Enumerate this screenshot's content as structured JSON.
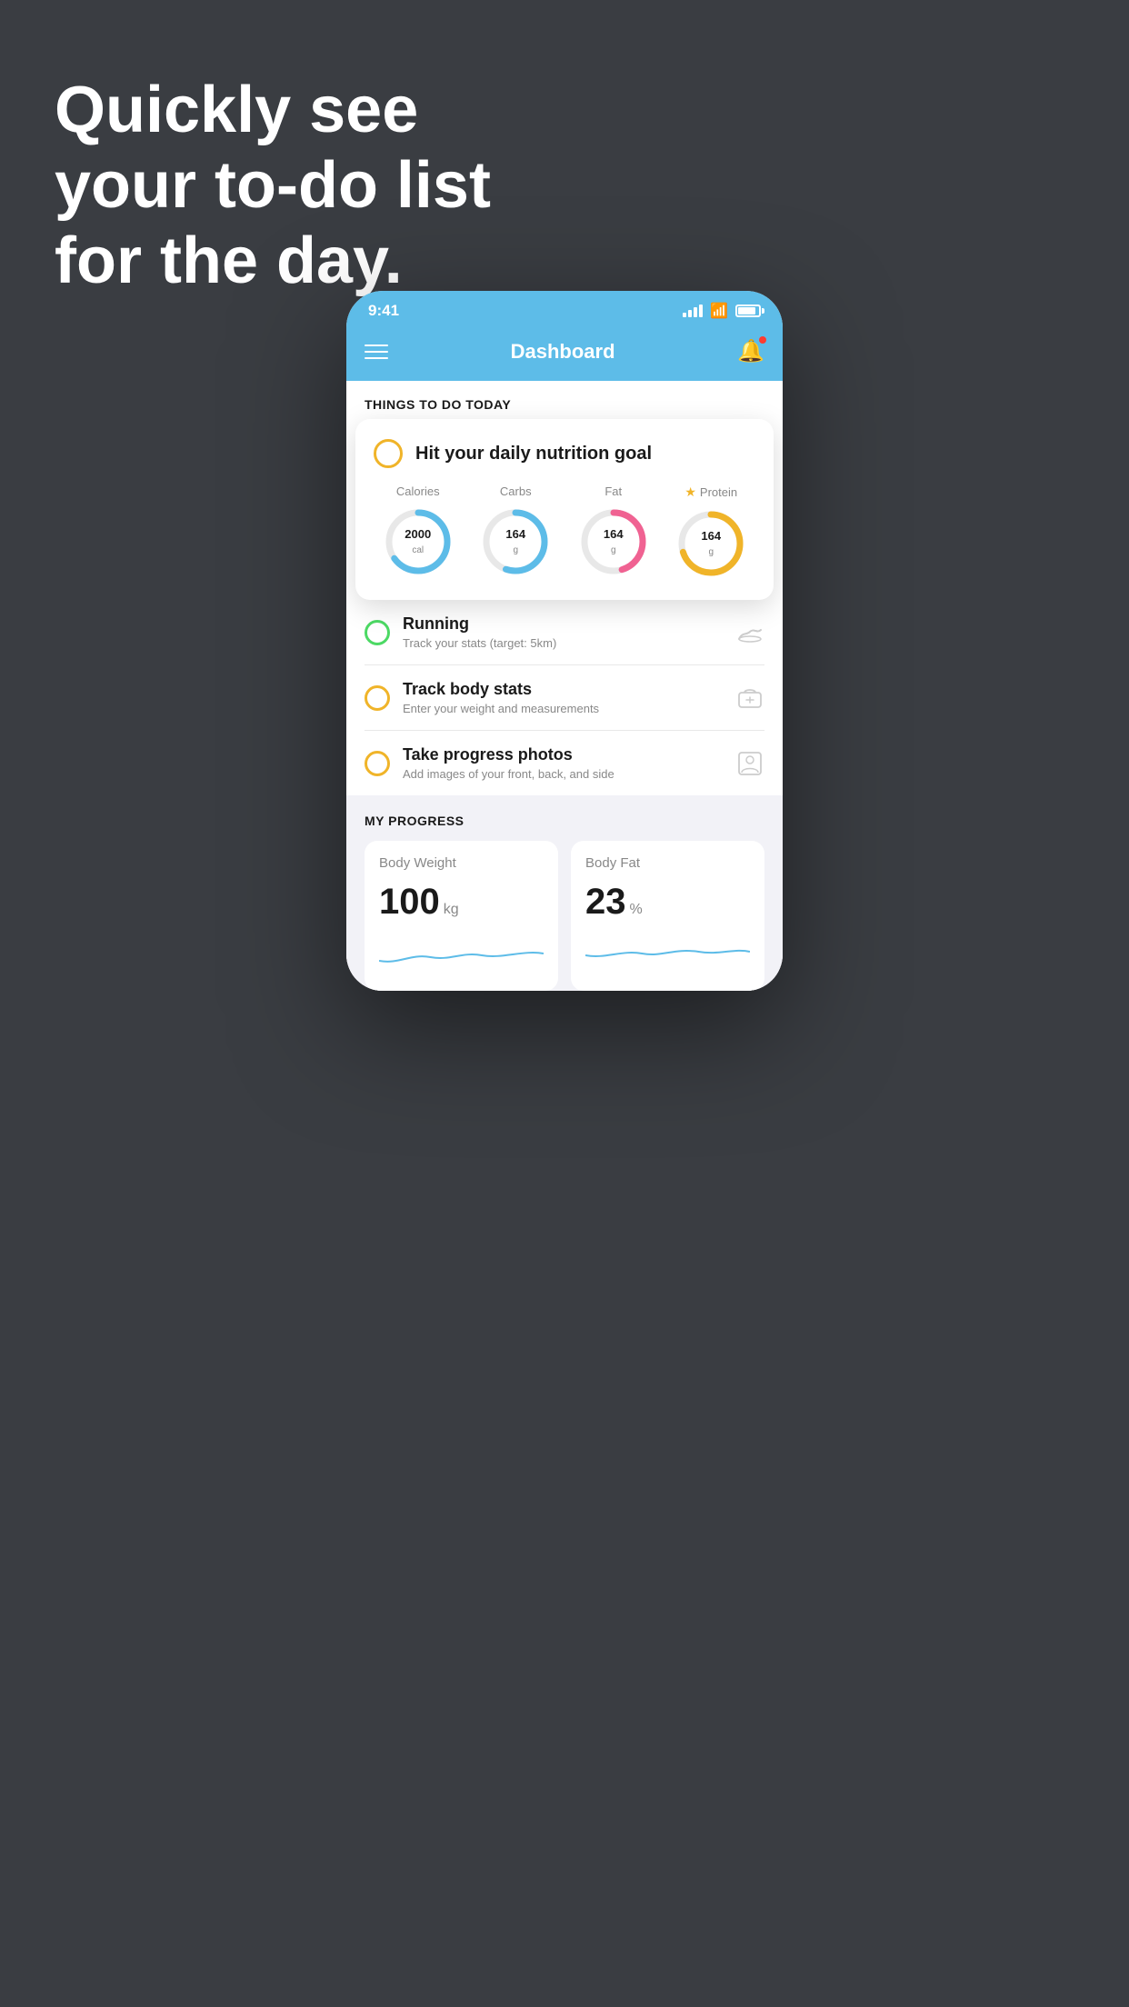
{
  "headline": {
    "line1": "Quickly see",
    "line2": "your to-do list",
    "line3": "for the day."
  },
  "statusBar": {
    "time": "9:41"
  },
  "navbar": {
    "title": "Dashboard"
  },
  "sectionHeader": "THINGS TO DO TODAY",
  "nutritionCard": {
    "circleLabel": "",
    "title": "Hit your daily nutrition goal",
    "items": [
      {
        "label": "Calories",
        "value": "2000",
        "unit": "cal",
        "color": "#5dbce8",
        "progress": 65,
        "star": false
      },
      {
        "label": "Carbs",
        "value": "164",
        "unit": "g",
        "color": "#5dbce8",
        "progress": 55,
        "star": false
      },
      {
        "label": "Fat",
        "value": "164",
        "unit": "g",
        "color": "#f06292",
        "progress": 45,
        "star": false
      },
      {
        "label": "Protein",
        "value": "164",
        "unit": "g",
        "color": "#f0b429",
        "progress": 70,
        "star": true
      }
    ]
  },
  "todoItems": [
    {
      "title": "Running",
      "subtitle": "Track your stats (target: 5km)",
      "circleColor": "green",
      "icon": "👟"
    },
    {
      "title": "Track body stats",
      "subtitle": "Enter your weight and measurements",
      "circleColor": "yellow",
      "icon": "⚖️"
    },
    {
      "title": "Take progress photos",
      "subtitle": "Add images of your front, back, and side",
      "circleColor": "yellow",
      "icon": "👤"
    }
  ],
  "progressSection": {
    "header": "MY PROGRESS",
    "cards": [
      {
        "title": "Body Weight",
        "value": "100",
        "unit": "kg"
      },
      {
        "title": "Body Fat",
        "value": "23",
        "unit": "%"
      }
    ]
  }
}
